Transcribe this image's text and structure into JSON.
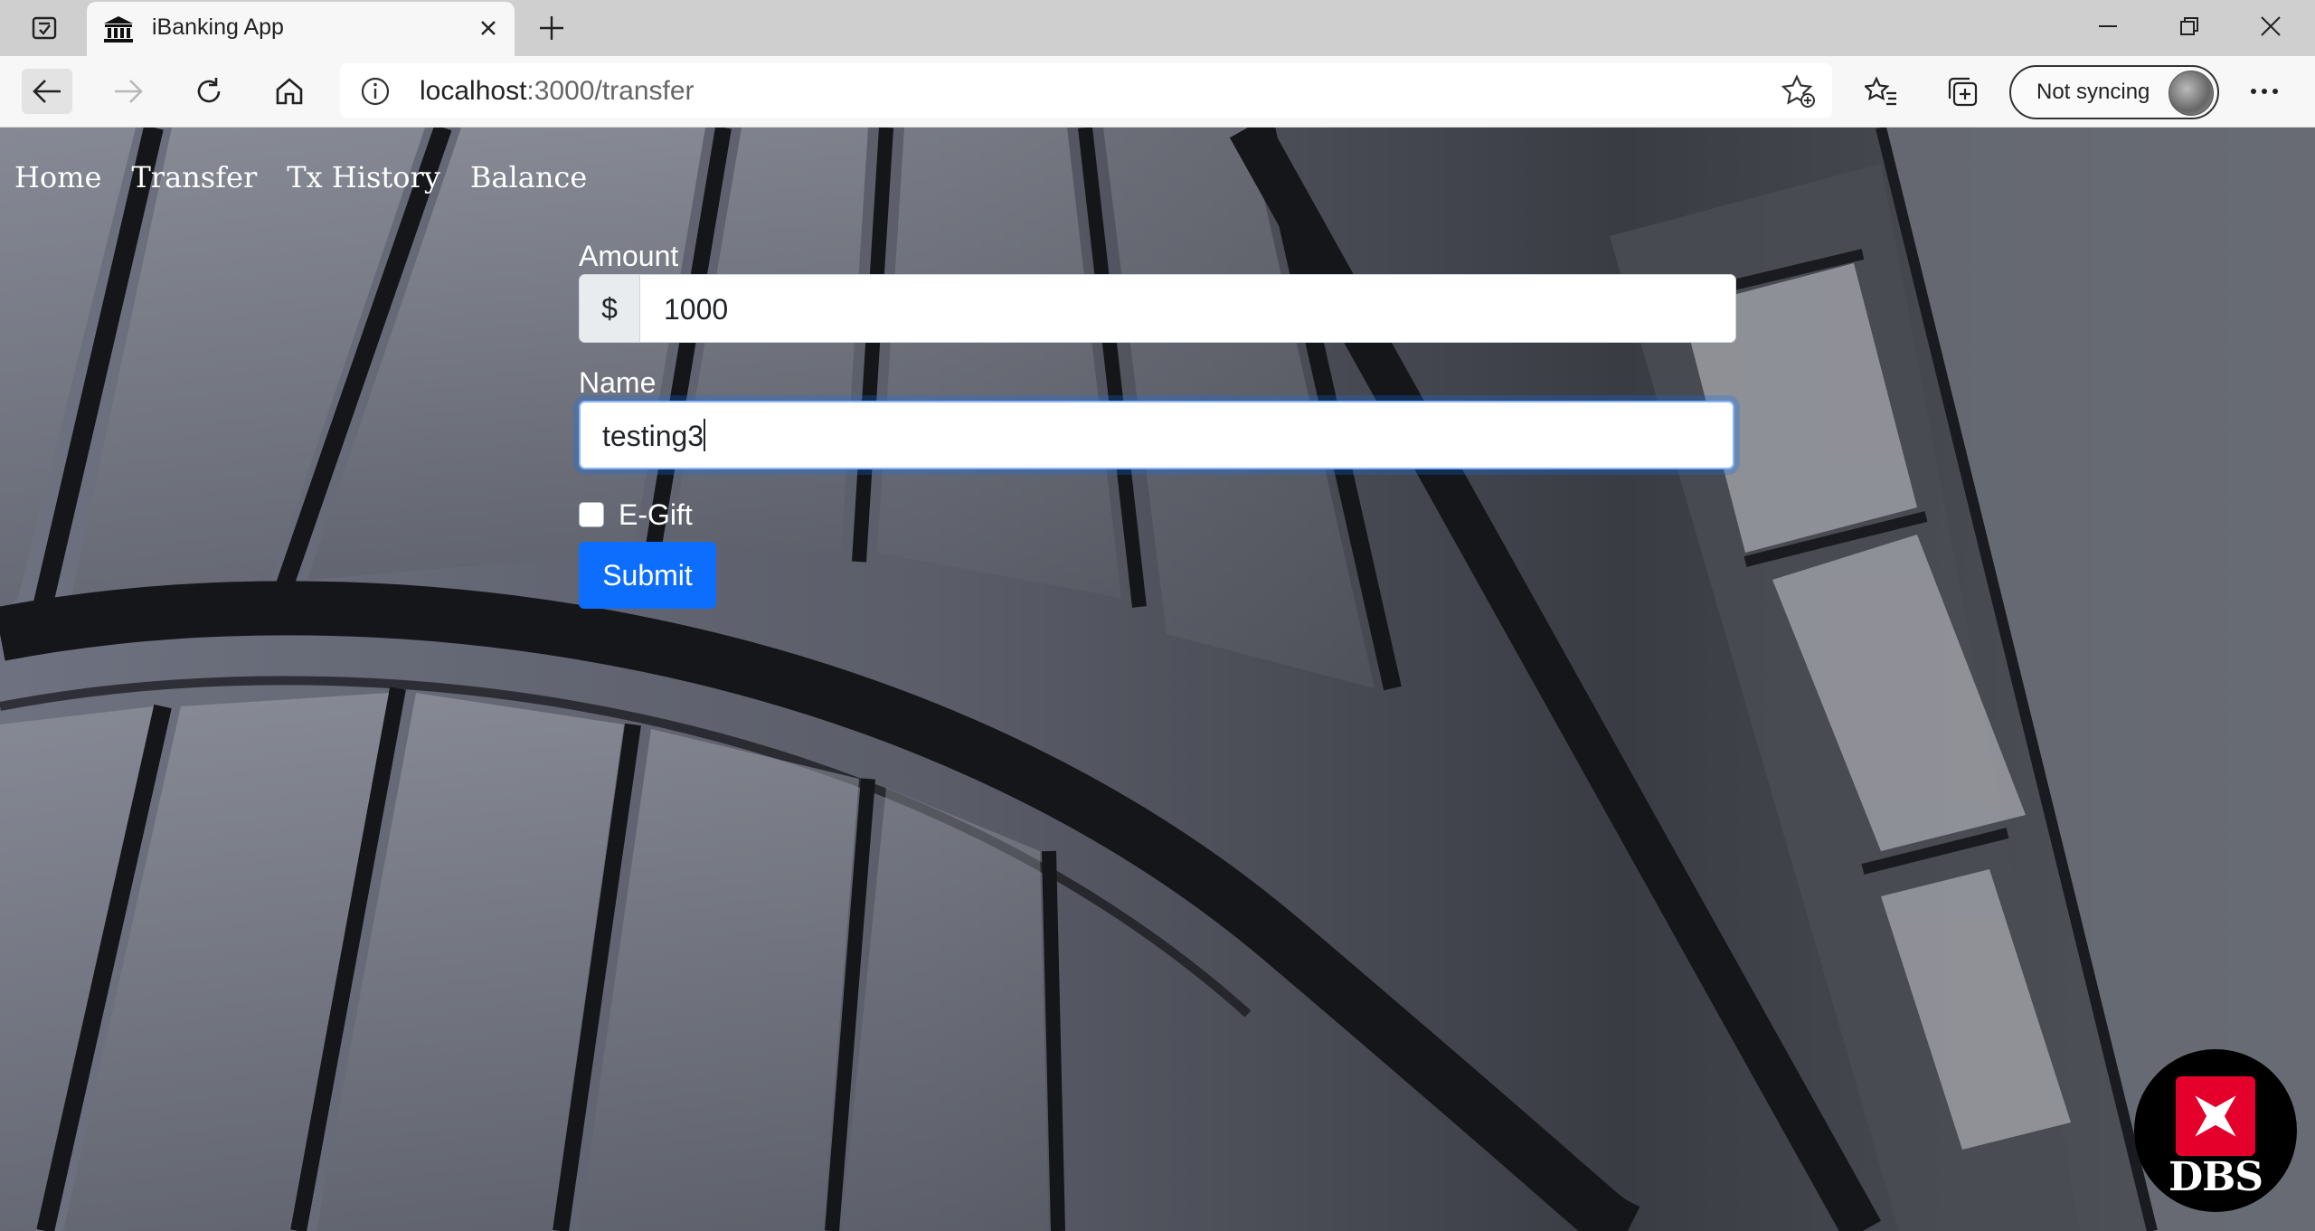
{
  "browser": {
    "tab_title": "iBanking App",
    "url_host": "localhost",
    "url_path": ":3000/transfer",
    "sync_label": "Not syncing"
  },
  "nav": {
    "items": [
      "Home",
      "Transfer",
      "Tx History",
      "Balance"
    ]
  },
  "form": {
    "amount_label": "Amount",
    "currency_prefix": "$",
    "amount_value": "1000",
    "name_label": "Name",
    "name_value": "testing3",
    "egift_label": "E-Gift",
    "egift_checked": false,
    "submit_label": "Submit"
  },
  "brand": {
    "logo_text": "DBS",
    "logo_color": "#e4002b"
  },
  "colors": {
    "primary": "#0d6efd",
    "focus_ring": "#86b7fe"
  }
}
